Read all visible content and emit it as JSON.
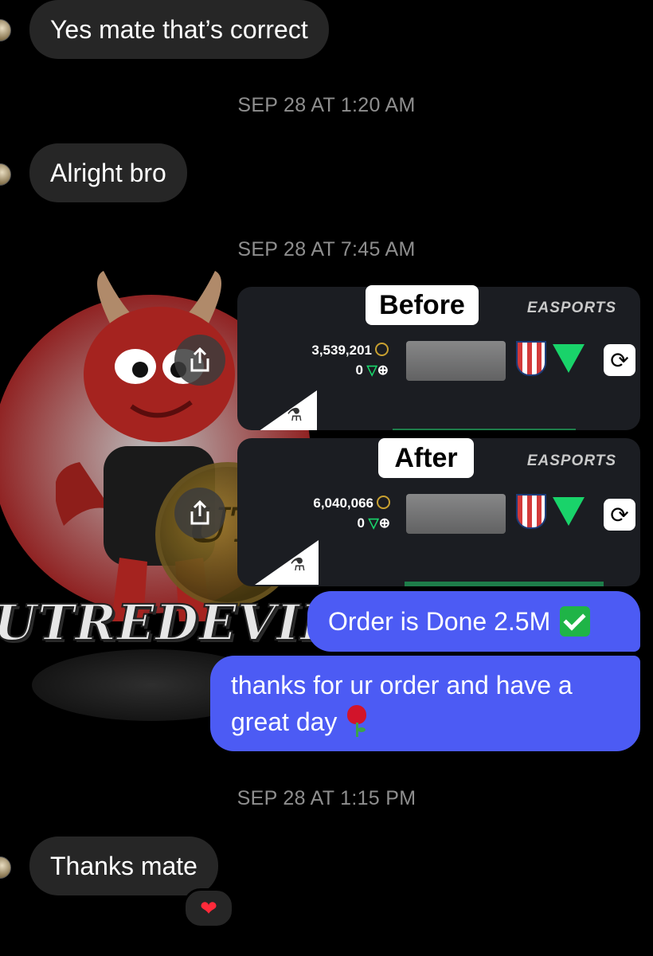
{
  "messages": {
    "m1": "Yes mate that’s correct",
    "m2": "Alright bro",
    "m3": "Order is Done 2.5M",
    "m4": "thanks for ur order and have a great day",
    "m5": "Thanks mate"
  },
  "timestamps": {
    "t1": "SEP 28 AT 1:20 AM",
    "t2": "SEP 28 AT 7:45 AM",
    "t3": "SEP 28 AT 1:15 PM"
  },
  "before_card": {
    "label": "Before",
    "brand": "EASPORTS",
    "coins": "3,539,201",
    "points": "0"
  },
  "after_card": {
    "label": "After",
    "brand": "EASPORTS",
    "coins": "6,040,066",
    "points": "0"
  },
  "watermark": {
    "text": "UTREDEVILS",
    "coin_text": "UT"
  },
  "reaction": {
    "icon": "heart-icon"
  },
  "colors": {
    "background": "#000000",
    "incoming_bubble": "#262626",
    "outgoing_bubble": "#4c5bf4",
    "timestamp": "#8e8e8e"
  }
}
